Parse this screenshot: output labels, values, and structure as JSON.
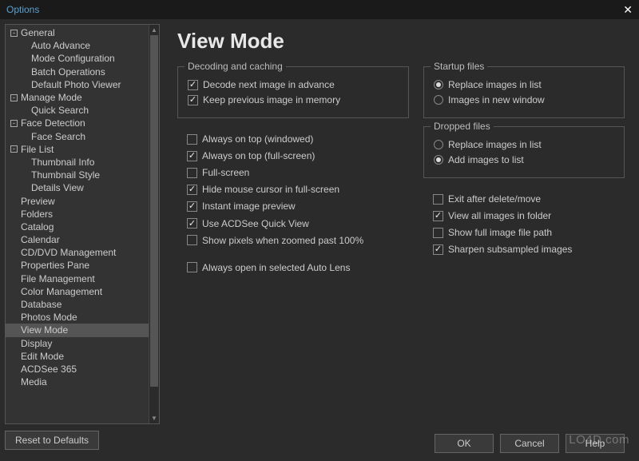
{
  "window": {
    "title": "Options",
    "close": "✕"
  },
  "sidebar": {
    "reset": "Reset to Defaults",
    "tree": [
      {
        "label": "General",
        "toggle": "-",
        "children": [
          {
            "label": "Auto Advance"
          },
          {
            "label": "Mode Configuration"
          },
          {
            "label": "Batch Operations"
          },
          {
            "label": "Default Photo Viewer"
          }
        ]
      },
      {
        "label": "Manage Mode",
        "toggle": "-",
        "children": [
          {
            "label": "Quick Search"
          }
        ]
      },
      {
        "label": "Face Detection",
        "toggle": "-",
        "children": [
          {
            "label": "Face Search"
          }
        ]
      },
      {
        "label": "File List",
        "toggle": "-",
        "children": [
          {
            "label": "Thumbnail Info"
          },
          {
            "label": "Thumbnail Style"
          },
          {
            "label": "Details View"
          }
        ]
      },
      {
        "label": "Preview"
      },
      {
        "label": "Folders"
      },
      {
        "label": "Catalog"
      },
      {
        "label": "Calendar"
      },
      {
        "label": "CD/DVD Management"
      },
      {
        "label": "Properties Pane"
      },
      {
        "label": "File Management"
      },
      {
        "label": "Color Management"
      },
      {
        "label": "Database"
      },
      {
        "label": "Photos Mode"
      },
      {
        "label": "View Mode",
        "selected": true
      },
      {
        "label": "Display"
      },
      {
        "label": "Edit Mode"
      },
      {
        "label": "ACDSee 365"
      },
      {
        "label": "Media"
      }
    ]
  },
  "page": {
    "title": "View Mode",
    "groups": {
      "decoding": {
        "legend": "Decoding and caching",
        "items": [
          {
            "label": "Decode next image in advance",
            "checked": true
          },
          {
            "label": "Keep previous image in memory",
            "checked": true
          }
        ]
      },
      "startup": {
        "legend": "Startup files",
        "items": [
          {
            "label": "Replace images in list",
            "checked": true
          },
          {
            "label": "Images in new window",
            "checked": false
          }
        ]
      },
      "dropped": {
        "legend": "Dropped files",
        "items": [
          {
            "label": "Replace images in list",
            "checked": false
          },
          {
            "label": "Add images to list",
            "checked": true
          }
        ]
      }
    },
    "leftChecks": [
      {
        "label": "Always on top (windowed)",
        "checked": false
      },
      {
        "label": "Always on top (full-screen)",
        "checked": true
      },
      {
        "label": "Full-screen",
        "checked": false
      },
      {
        "label": "Hide mouse cursor in full-screen",
        "checked": true
      },
      {
        "label": "Instant image preview",
        "checked": true
      },
      {
        "label": "Use ACDSee Quick View",
        "checked": true
      },
      {
        "label": "Show pixels when zoomed past 100%",
        "checked": false
      },
      {
        "label": "Always open in selected Auto Lens",
        "checked": false
      }
    ],
    "rightChecks": [
      {
        "label": "Exit after delete/move",
        "checked": false
      },
      {
        "label": "View all images in folder",
        "checked": true
      },
      {
        "label": "Show full image file path",
        "checked": false
      },
      {
        "label": "Sharpen subsampled images",
        "checked": true
      }
    ]
  },
  "footer": {
    "ok": "OK",
    "cancel": "Cancel",
    "help": "Help"
  },
  "watermark": "LO4D.com"
}
